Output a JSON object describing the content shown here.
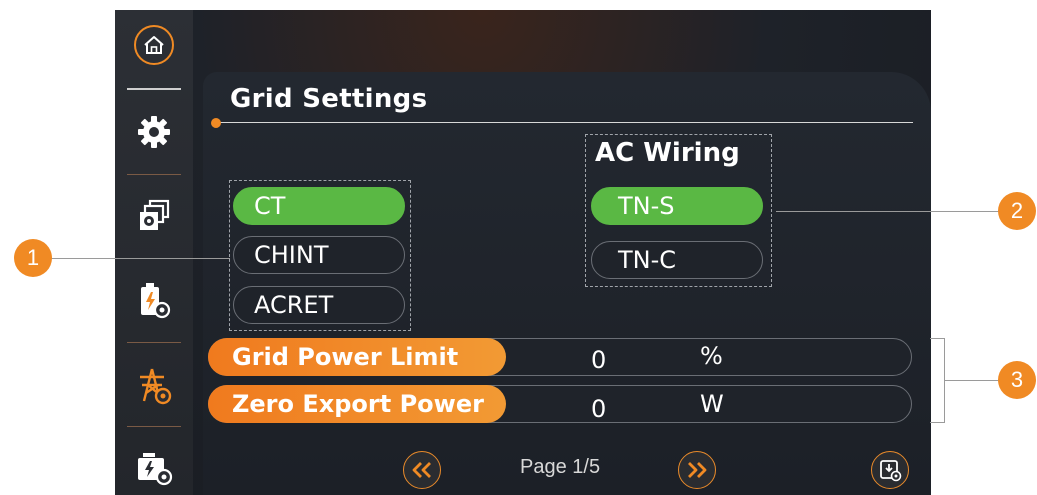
{
  "sidebar": {
    "icons": [
      "home-icon",
      "gear-icon",
      "system-settings-icon",
      "battery-settings-icon",
      "grid-settings-icon",
      "generator-settings-icon"
    ],
    "active": "grid-settings-icon",
    "accent": "#f08a24"
  },
  "page": {
    "title": "Grid Settings"
  },
  "meter": {
    "options": [
      {
        "label": "CT",
        "active": true
      },
      {
        "label": "CHINT",
        "active": false
      },
      {
        "label": "ACRET",
        "active": false
      }
    ]
  },
  "ac_wiring": {
    "title": "AC Wiring",
    "options": [
      {
        "label": "TN-S",
        "active": true
      },
      {
        "label": "TN-C",
        "active": false
      }
    ]
  },
  "settings": [
    {
      "label": "Grid Power Limit",
      "value": "0",
      "unit": "%"
    },
    {
      "label": "Zero Export Power",
      "value": "0",
      "unit": "W"
    }
  ],
  "footer": {
    "page_text": "Page 1/5",
    "prev_icon": "double-chevron-left-icon",
    "next_icon": "double-chevron-right-icon",
    "save_icon": "save-settings-icon"
  },
  "callouts": [
    "1",
    "2",
    "3"
  ],
  "colors": {
    "active_green": "#5ab844",
    "accent_orange": "#f08a24"
  }
}
